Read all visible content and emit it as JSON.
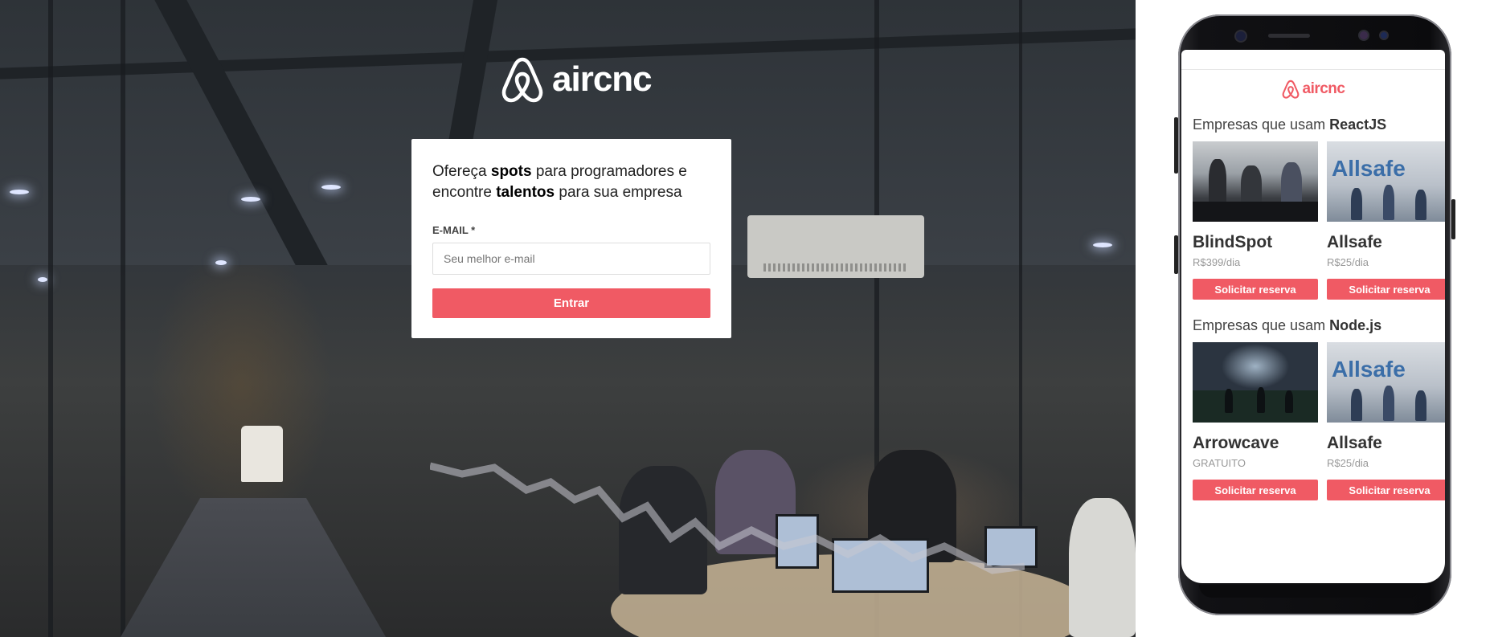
{
  "brand": {
    "name": "aircnc",
    "color": "#f05a64"
  },
  "login": {
    "headline": {
      "p1": "Ofereça ",
      "spots": "spots",
      "p2": " para programadores e encontre ",
      "talentos": "talentos",
      "p3": " para sua empresa"
    },
    "email_label": "E-MAIL *",
    "email_placeholder": "Seu melhor e-mail",
    "email_value": "",
    "submit_label": "Entrar"
  },
  "mobile": {
    "sections": [
      {
        "title_prefix": "Empresas que usam ",
        "tech": "ReactJS",
        "spots": [
          {
            "company": "BlindSpot",
            "price": "R$399/dia",
            "button": "Solicitar reserva"
          },
          {
            "company": "Allsafe",
            "price": "R$25/dia",
            "button": "Solicitar reserva"
          }
        ]
      },
      {
        "title_prefix": "Empresas que usam ",
        "tech": "Node.js",
        "spots": [
          {
            "company": "Arrowcave",
            "price": "GRATUITO",
            "button": "Solicitar reserva"
          },
          {
            "company": "Allsafe",
            "price": "R$25/dia",
            "button": "Solicitar reserva"
          }
        ]
      }
    ]
  }
}
